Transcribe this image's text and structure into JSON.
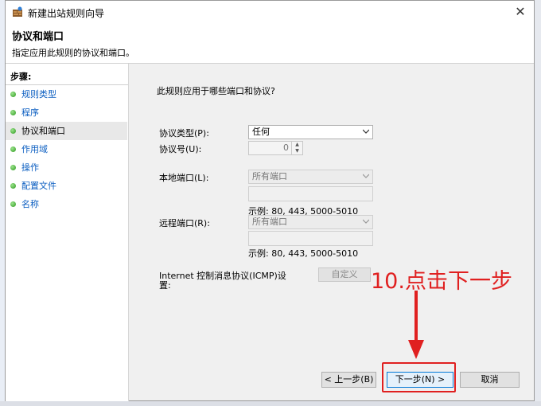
{
  "window": {
    "title": "新建出站规则向导",
    "close_glyph": "✕"
  },
  "header": {
    "title": "协议和端口",
    "subtitle": "指定应用此规则的协议和端口。"
  },
  "steps": {
    "title": "步骤:",
    "items": [
      {
        "label": "规则类型"
      },
      {
        "label": "程序"
      },
      {
        "label": "协议和端口",
        "active": true
      },
      {
        "label": "作用域"
      },
      {
        "label": "操作"
      },
      {
        "label": "配置文件"
      },
      {
        "label": "名称"
      }
    ]
  },
  "form": {
    "question": "此规则应用于哪些端口和协议?",
    "protocol_type_label": "协议类型(P):",
    "protocol_type_value": "任何",
    "protocol_number_label": "协议号(U):",
    "protocol_number_value": "0",
    "local_port_label": "本地端口(L):",
    "local_port_value": "所有端口",
    "local_port_example": "示例: 80, 443, 5000-5010",
    "remote_port_label": "远程端口(R):",
    "remote_port_value": "所有端口",
    "remote_port_example": "示例: 80, 443, 5000-5010",
    "icmp_label_line1": "Internet 控制消息协议(ICMP)设",
    "icmp_label_line2": "置:",
    "custom_button": "自定义"
  },
  "footer": {
    "back_button": "< 上一步(B)",
    "next_button": "下一步(N) >",
    "cancel_button": "取消"
  },
  "annotation": {
    "text": "10.点击下一步",
    "color": "#e02020"
  }
}
